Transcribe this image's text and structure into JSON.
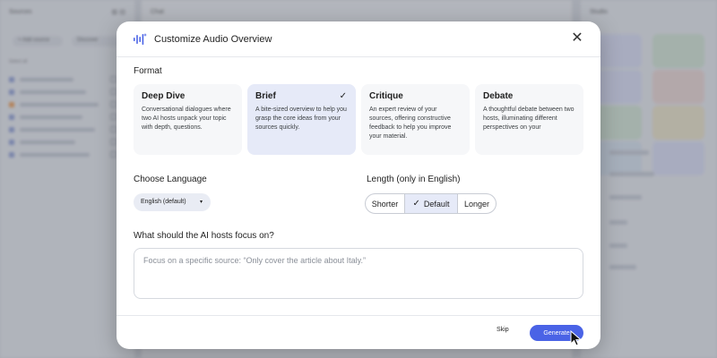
{
  "background": {
    "left_header": "Sources",
    "right_header": "Studio",
    "middle_header": "Chat",
    "left_buttons": [
      "+ Add source",
      "Discover"
    ],
    "left_section": "Select all",
    "source_dot_colors": [
      "#8a9bd6",
      "#8a9bd6",
      "#f2994a",
      "#8a9bd6",
      "#8a9bd6",
      "#8a9bd6",
      "#8a9bd6"
    ],
    "tile_colors": [
      "#dfe3fb",
      "#d7ecd8",
      "#dfe3fb",
      "#f4dbd7",
      "#d7ecd8",
      "#f3e8c9",
      "#dbe7f5",
      "#dfe3fb"
    ]
  },
  "dialog": {
    "title": "Customize Audio Overview",
    "icons": {
      "header": "audio-waveform-icon",
      "close": "close-icon",
      "check": "checkmark-icon",
      "caret": "caret-down-icon",
      "cursor": "mouse-pointer-icon"
    },
    "format_label": "Format",
    "formats": [
      {
        "title": "Deep Dive",
        "desc": "Conversational dialogues where two AI hosts unpack your topic with depth, questions.",
        "selected": false
      },
      {
        "title": "Brief",
        "desc": "A bite-sized overview to help you grasp the core ideas from your sources quickly.",
        "selected": true
      },
      {
        "title": "Critique",
        "desc": "An expert review of your sources, offering constructive feedback to help you improve your material.",
        "selected": false
      },
      {
        "title": "Debate",
        "desc": "A thoughtful debate between two hosts, illuminating different perspectives on your",
        "selected": false
      }
    ],
    "check_glyph": "✓",
    "language_label": "Choose Language",
    "language_value": "English (default)",
    "caret_glyph": "▾",
    "length_label": "Length (only in English)",
    "length_options": [
      "Shorter",
      "Default",
      "Longer"
    ],
    "length_selected": "Default",
    "focus_label": "What should the AI hosts focus on?",
    "focus_placeholder": "Focus on a specific source: “Only cover the article about Italy.”",
    "skip_label": "Skip",
    "generate_label": "Generate",
    "accent": "#4a63e6",
    "selected_bg": "#e6eaf8",
    "close_glyph": "✕"
  }
}
